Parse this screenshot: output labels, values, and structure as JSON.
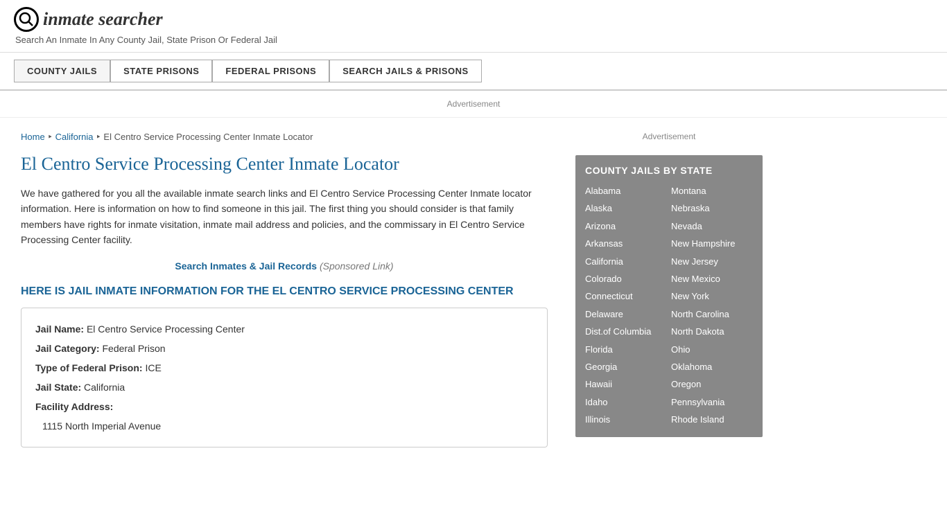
{
  "header": {
    "logo_icon": "🔍",
    "logo_text": "inmate searcher",
    "tagline": "Search An Inmate In Any County Jail, State Prison Or Federal Jail"
  },
  "nav": {
    "items": [
      {
        "label": "COUNTY JAILS",
        "active": true
      },
      {
        "label": "STATE PRISONS",
        "active": false
      },
      {
        "label": "FEDERAL PRISONS",
        "active": false
      },
      {
        "label": "SEARCH JAILS & PRISONS",
        "active": false
      }
    ]
  },
  "ad": {
    "label": "Advertisement"
  },
  "breadcrumb": {
    "home": "Home",
    "state": "California",
    "current": "El Centro Service Processing Center Inmate Locator"
  },
  "page": {
    "title": "El Centro Service Processing Center Inmate Locator",
    "body_text": "We have gathered for you all the available inmate search links and El Centro Service Processing Center Inmate locator information. Here is information on how to find someone in this jail. The first thing you should consider is that family members have rights for inmate visitation, inmate mail address and policies, and the commissary in El Centro Service Processing Center facility.",
    "search_link_text": "Search Inmates & Jail Records",
    "search_sponsored": "(Sponsored Link)",
    "section_heading": "HERE IS JAIL INMATE INFORMATION FOR THE EL CENTRO SERVICE PROCESSING CENTER"
  },
  "info_box": {
    "jail_name_label": "Jail Name:",
    "jail_name_value": "El Centro Service Processing Center",
    "jail_category_label": "Jail Category:",
    "jail_category_value": "Federal Prison",
    "federal_type_label": "Type of Federal Prison:",
    "federal_type_value": "ICE",
    "jail_state_label": "Jail State:",
    "jail_state_value": "California",
    "facility_address_label": "Facility Address:",
    "facility_address_value": "1115 North Imperial Avenue"
  },
  "sidebar": {
    "ad_label": "Advertisement",
    "state_box_title": "COUNTY JAILS BY STATE",
    "states_col1": [
      "Alabama",
      "Alaska",
      "Arizona",
      "Arkansas",
      "California",
      "Colorado",
      "Connecticut",
      "Delaware",
      "Dist.of Columbia",
      "Florida",
      "Georgia",
      "Hawaii",
      "Idaho",
      "Illinois"
    ],
    "states_col2": [
      "Montana",
      "Nebraska",
      "Nevada",
      "New Hampshire",
      "New Jersey",
      "New Mexico",
      "New York",
      "North Carolina",
      "North Dakota",
      "Ohio",
      "Oklahoma",
      "Oregon",
      "Pennsylvania",
      "Rhode Island"
    ]
  }
}
